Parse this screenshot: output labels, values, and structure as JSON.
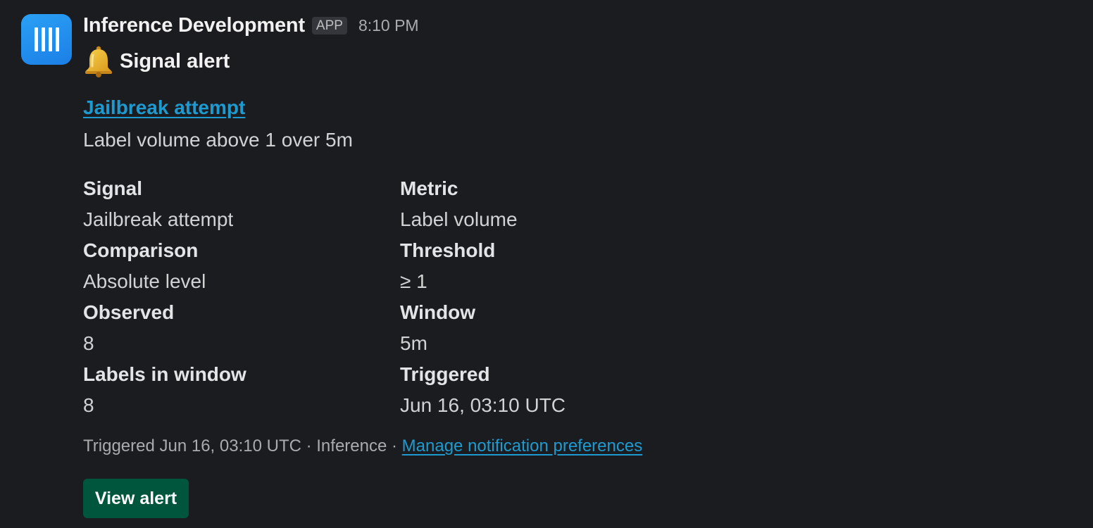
{
  "message": {
    "app_name": "Inference Development",
    "app_badge": "APP",
    "timestamp": "8:10 PM",
    "avatar_icon": "barcode-bars-icon",
    "avatar_color": "#1d8cf0",
    "title_icon": "bell-icon",
    "title": "Signal alert",
    "alert_link": "Jailbreak attempt",
    "alert_description": "Label volume above 1 over 5m",
    "fields": [
      [
        {
          "label": "Signal",
          "value": "Jailbreak attempt"
        },
        {
          "label": "Metric",
          "value": "Label volume"
        }
      ],
      [
        {
          "label": "Comparison",
          "value": "Absolute level"
        },
        {
          "label": "Threshold",
          "value": "≥ 1"
        }
      ],
      [
        {
          "label": "Observed",
          "value": "8"
        },
        {
          "label": "Window",
          "value": "5m"
        }
      ],
      [
        {
          "label": "Labels in window",
          "value": "8"
        },
        {
          "label": "Triggered",
          "value": "Jun 16, 03:10 UTC"
        }
      ]
    ],
    "footer": {
      "text": "Triggered Jun 16, 03:10 UTC · Inference · ",
      "link": "Manage notification preferences"
    },
    "button_label": "View alert",
    "colors": {
      "background": "#1b1c20",
      "link": "#1d9bd1",
      "button": "#00553d"
    }
  }
}
